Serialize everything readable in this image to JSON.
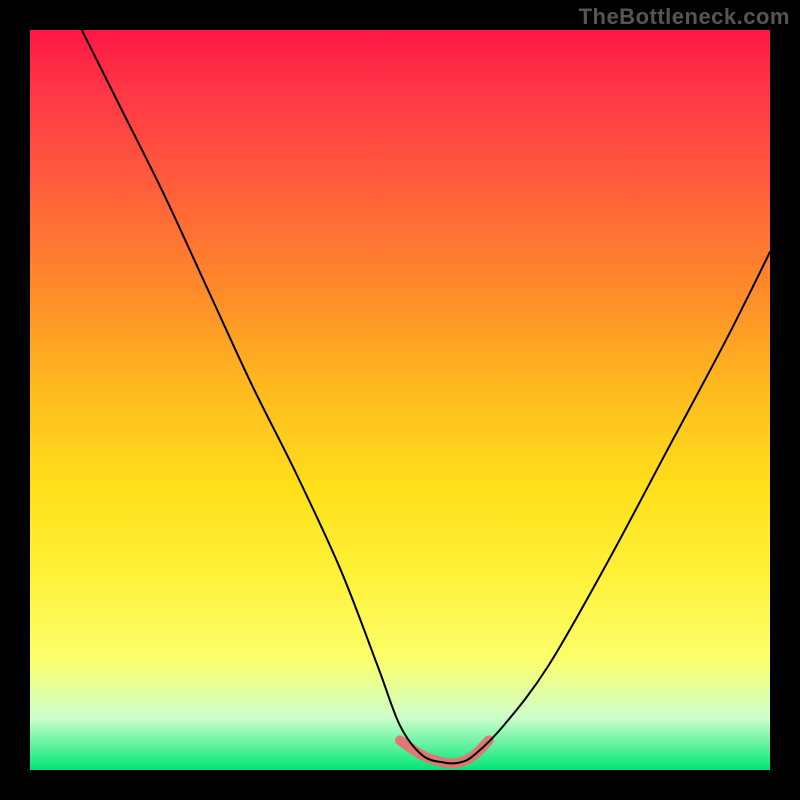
{
  "watermark": "TheBottleneck.com",
  "colors": {
    "frame_background": "#000000",
    "gradient_top": "#ff1744",
    "gradient_mid": "#ffe01a",
    "gradient_bottom": "#00e676",
    "curve_stroke": "#000000",
    "highlight_stroke": "#e57373",
    "watermark_text": "#555555"
  },
  "chart_data": {
    "type": "line",
    "title": "",
    "xlabel": "",
    "ylabel": "",
    "xlim": [
      0,
      100
    ],
    "ylim": [
      0,
      100
    ],
    "series": [
      {
        "name": "bottleneck-curve",
        "x": [
          7,
          12,
          18,
          24,
          30,
          36,
          42,
          47,
          50,
          53,
          56,
          58,
          60,
          64,
          70,
          78,
          86,
          94,
          100
        ],
        "y": [
          100,
          90,
          78,
          65,
          52,
          40,
          27,
          14,
          6,
          2,
          1,
          1,
          2,
          6,
          14,
          28,
          43,
          58,
          70
        ]
      },
      {
        "name": "optimal-range-highlight",
        "x": [
          50,
          53,
          56,
          58,
          60,
          62
        ],
        "y": [
          4,
          2,
          1,
          1,
          2,
          4
        ]
      }
    ],
    "annotations": []
  }
}
